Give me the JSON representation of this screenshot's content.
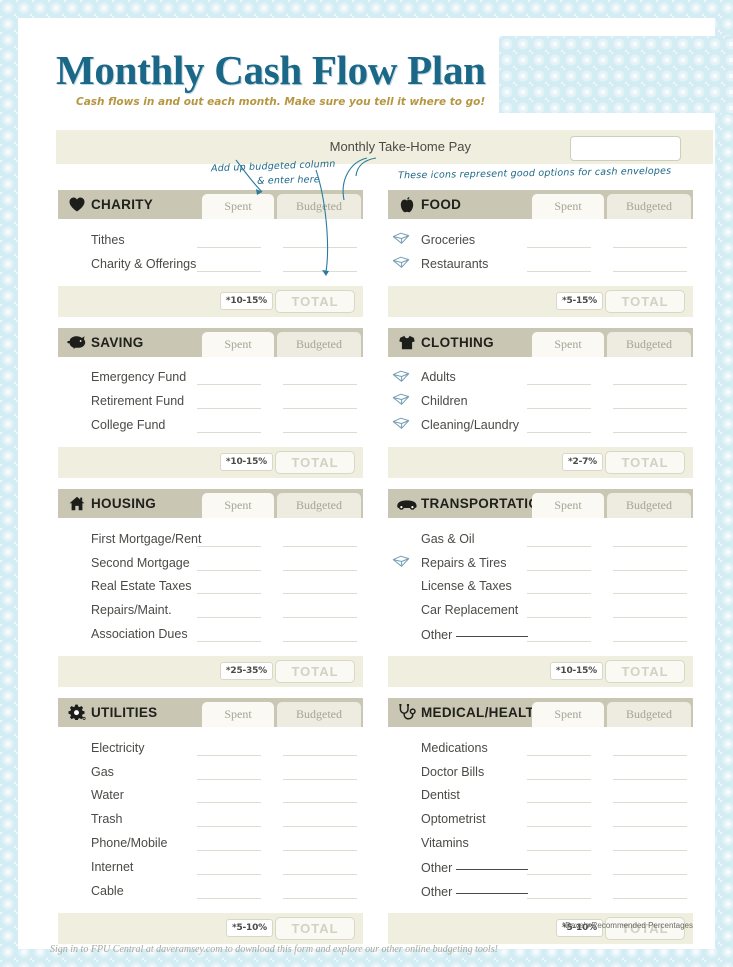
{
  "header": {
    "title": "Monthly Cash Flow Plan",
    "subtitle": "Cash flows in and out each month. Make sure you tell it where to go!",
    "takehome_label": "Monthly Take-Home Pay",
    "takehome_value": "",
    "takehome_placeholder": ""
  },
  "annotations": {
    "line1": "Add up budgeted column",
    "line2": "& enter here",
    "line3": "These icons represent good options for cash envelopes"
  },
  "columns": {
    "spent": "Spent",
    "budgeted": "Budgeted",
    "total": "TOTAL"
  },
  "sections": [
    {
      "id": "charity",
      "title": "CHARITY",
      "icon": "heart-icon",
      "percent": "*10-15%",
      "column": "left",
      "rows": [
        {
          "label": "Tithes",
          "envelope": false,
          "blank": false
        },
        {
          "label": "Charity & Offerings",
          "envelope": false,
          "blank": false
        }
      ]
    },
    {
      "id": "saving",
      "title": "SAVING",
      "icon": "piggy-bank-icon",
      "percent": "*10-15%",
      "column": "left",
      "rows": [
        {
          "label": "Emergency Fund",
          "envelope": false,
          "blank": false
        },
        {
          "label": "Retirement Fund",
          "envelope": false,
          "blank": false
        },
        {
          "label": "College Fund",
          "envelope": false,
          "blank": false
        }
      ]
    },
    {
      "id": "housing",
      "title": "HOUSING",
      "icon": "house-icon",
      "percent": "*25-35%",
      "column": "left",
      "rows": [
        {
          "label": "First Mortgage/Rent",
          "envelope": false,
          "blank": false
        },
        {
          "label": "Second Mortgage",
          "envelope": false,
          "blank": false
        },
        {
          "label": "Real Estate Taxes",
          "envelope": false,
          "blank": false
        },
        {
          "label": "Repairs/Maint.",
          "envelope": false,
          "blank": false
        },
        {
          "label": "Association Dues",
          "envelope": false,
          "blank": false
        }
      ]
    },
    {
      "id": "utilities",
      "title": "UTILITIES",
      "icon": "gear-icon",
      "percent": "*5-10%",
      "column": "left",
      "rows": [
        {
          "label": "Electricity",
          "envelope": false,
          "blank": false
        },
        {
          "label": "Gas",
          "envelope": false,
          "blank": false
        },
        {
          "label": "Water",
          "envelope": false,
          "blank": false
        },
        {
          "label": "Trash",
          "envelope": false,
          "blank": false
        },
        {
          "label": "Phone/Mobile",
          "envelope": false,
          "blank": false
        },
        {
          "label": "Internet",
          "envelope": false,
          "blank": false
        },
        {
          "label": "Cable",
          "envelope": false,
          "blank": false
        }
      ]
    },
    {
      "id": "food",
      "title": "FOOD",
      "icon": "apple-icon",
      "percent": "*5-15%",
      "column": "right",
      "rows": [
        {
          "label": "Groceries",
          "envelope": true,
          "blank": false
        },
        {
          "label": "Restaurants",
          "envelope": true,
          "blank": false
        }
      ]
    },
    {
      "id": "clothing",
      "title": "CLOTHING",
      "icon": "tshirt-icon",
      "percent": "*2-7%",
      "column": "right",
      "rows": [
        {
          "label": "Adults",
          "envelope": true,
          "blank": false
        },
        {
          "label": "Children",
          "envelope": true,
          "blank": false
        },
        {
          "label": "Cleaning/Laundry",
          "envelope": true,
          "blank": false
        }
      ]
    },
    {
      "id": "transportation",
      "title": "TRANSPORTATION",
      "icon": "car-icon",
      "percent": "*10-15%",
      "column": "right",
      "rows": [
        {
          "label": "Gas & Oil",
          "envelope": false,
          "blank": false
        },
        {
          "label": "Repairs & Tires",
          "envelope": true,
          "blank": false
        },
        {
          "label": "License & Taxes",
          "envelope": false,
          "blank": false
        },
        {
          "label": "Car Replacement",
          "envelope": false,
          "blank": false
        },
        {
          "label": "Other",
          "envelope": false,
          "blank": true
        }
      ]
    },
    {
      "id": "medical-health",
      "title": "MEDICAL/HEALTH",
      "icon": "stethoscope-icon",
      "percent": "*5-10%",
      "column": "right",
      "rows": [
        {
          "label": "Medications",
          "envelope": false,
          "blank": false
        },
        {
          "label": "Doctor Bills",
          "envelope": false,
          "blank": false
        },
        {
          "label": "Dentist",
          "envelope": false,
          "blank": false
        },
        {
          "label": "Optometrist",
          "envelope": false,
          "blank": false
        },
        {
          "label": "Vitamins",
          "envelope": false,
          "blank": false
        },
        {
          "label": "Other",
          "envelope": false,
          "blank": true
        },
        {
          "label": "Other",
          "envelope": false,
          "blank": true
        }
      ]
    }
  ],
  "footer": {
    "note": "*Dave's Recommended Percentages",
    "signin": "Sign in to FPU Central at daveramsey.com to download this form and explore our other online budgeting tools!"
  },
  "colors": {
    "title_blue": "#1b6787",
    "subtitle_gold": "#b79641",
    "header_tan": "#c9c7b3",
    "band_cream": "#f0efdf",
    "background_blue": "#d4edf4"
  }
}
